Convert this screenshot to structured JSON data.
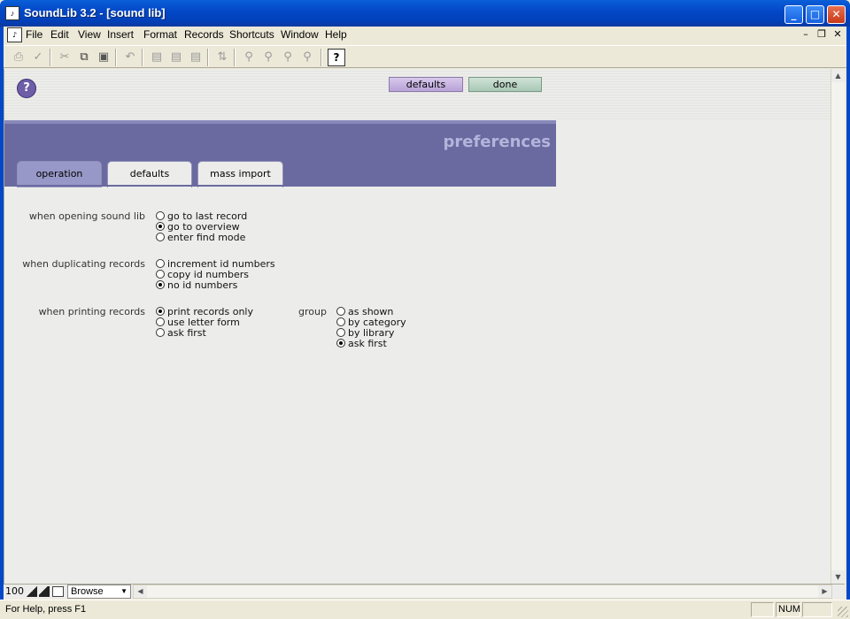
{
  "window": {
    "title": "SoundLib 3.2 - [sound lib]",
    "minimize": "_",
    "maximize": "□",
    "close": "✕"
  },
  "menu": [
    "File",
    "Edit",
    "View",
    "Insert",
    "Format",
    "Records",
    "Shortcuts",
    "Window",
    "Help"
  ],
  "toolbar": {
    "help_icon": "?"
  },
  "header": {
    "help_label": "?",
    "defaults_button": "defaults",
    "done_button": "done"
  },
  "banner": {
    "title": "preferences",
    "tabs": [
      "operation",
      "defaults",
      "mass import"
    ],
    "active_tab": "operation"
  },
  "sections": {
    "opening": {
      "label": "when opening sound lib",
      "options": [
        {
          "label": "go to last record",
          "selected": false
        },
        {
          "label": "go to overview",
          "selected": true
        },
        {
          "label": "enter find mode",
          "selected": false
        }
      ]
    },
    "duplicating": {
      "label": "when duplicating records",
      "options": [
        {
          "label": "increment id numbers",
          "selected": false
        },
        {
          "label": "copy id numbers",
          "selected": false
        },
        {
          "label": "no id numbers",
          "selected": true
        }
      ]
    },
    "printing": {
      "label": "when printing records",
      "options": [
        {
          "label": "print records only",
          "selected": true
        },
        {
          "label": "use letter form",
          "selected": false
        },
        {
          "label": "ask first",
          "selected": false
        }
      ]
    },
    "group": {
      "label": "group",
      "options": [
        {
          "label": "as shown",
          "selected": false
        },
        {
          "label": "by category",
          "selected": false
        },
        {
          "label": "by library",
          "selected": false
        },
        {
          "label": "ask first",
          "selected": true
        }
      ]
    }
  },
  "bottom": {
    "zoom": "100",
    "mode": "Browse"
  },
  "status": {
    "text": "For Help, press F1",
    "num": "NUM"
  },
  "colors": {
    "banner": "#6a6aa0",
    "defaults_btn": "#c8b6e2",
    "done_btn": "#b8d4c2"
  }
}
